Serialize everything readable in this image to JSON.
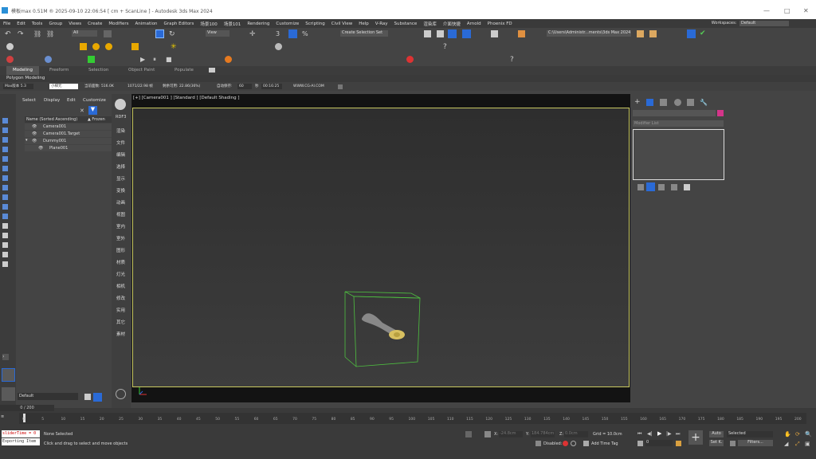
{
  "window": {
    "title": "模板max 0.51M ® 2025-09-10 22:06:54  [ cm + ScanLine ] - Autodesk 3ds Max 2024"
  },
  "menu": [
    "File",
    "Edit",
    "Tools",
    "Group",
    "Views",
    "Create",
    "Modifiers",
    "Animation",
    "Graph Editors",
    "场景100",
    "场景101",
    "Rendering",
    "Customize",
    "Scripting",
    "Civil View",
    "Help",
    "V-Ray",
    "Substance",
    "渲染库",
    "介面快捷",
    "Arnold",
    "Phoenix FD"
  ],
  "workspaces": {
    "label": "Workspaces:",
    "value": "Default"
  },
  "toolbar": {
    "filter": "All",
    "view": "View",
    "selection_set": "Create Selection Set",
    "path": "C:\\Users\\Administr...ments\\3ds Max 2024"
  },
  "ribbon": {
    "tabs": [
      "Modeling",
      "Freeform",
      "Selection",
      "Object Paint",
      "Populate"
    ],
    "active": "Modeling",
    "sub": "Polygon Modeling"
  },
  "infobar": {
    "version": "Max版本 5.3",
    "input": "小梯元",
    "face_count": "当前面数: 516.0K",
    "fps": "1071/22.98 帧",
    "cache": "剩余可用: 22.86(36%)",
    "save_interval": "自动保存:",
    "sec_val": "60",
    "sec_unit": "秒",
    "time": "00:16:25",
    "site": "WWW.CG-AI.COM"
  },
  "scene_explorer": {
    "tabs": [
      "Select",
      "Display",
      "Edit",
      "Customize"
    ],
    "col_name": "Name (Sorted Ascending)",
    "col_frozen": "▲ Frozen",
    "items": [
      "Camera001",
      "Camera001.Target",
      "Dummy001",
      "Plane001"
    ]
  },
  "command_panel": [
    "渲染",
    "文件",
    "编辑",
    "选择",
    "显示",
    "变换",
    "动画",
    "视图",
    "室内",
    "室外",
    "图形",
    "材质",
    "灯光",
    "相机",
    "修改",
    "实用",
    "其它",
    "素材"
  ],
  "cmd_header": "RDF3",
  "viewport": {
    "label": "[+] [Camera001 ] [Standard ] [Default Shading ]"
  },
  "modify": {
    "modifier_list": "Modifier List"
  },
  "layer": {
    "value": "Default"
  },
  "timeline": {
    "frame": "0 / 200",
    "ticks": [
      "0",
      "5",
      "10",
      "15",
      "20",
      "25",
      "30",
      "35",
      "40",
      "45",
      "50",
      "55",
      "60",
      "65",
      "70",
      "75",
      "80",
      "85",
      "90",
      "95",
      "100",
      "105",
      "110",
      "115",
      "120",
      "125",
      "130",
      "135",
      "140",
      "145",
      "150",
      "155",
      "160",
      "165",
      "170",
      "175",
      "180",
      "185",
      "190",
      "195",
      "200"
    ]
  },
  "status": {
    "script1": "sliderTime = 0",
    "script2": "Exporting Item",
    "selection": "None Selected",
    "hint": "Click and drag to select and move objects",
    "x_label": "X:",
    "x_val": "-24.8cm",
    "y_label": "Y:",
    "y_val": "184.784cm",
    "z_label": "Z:",
    "z_val": "0.0cm",
    "grid": "Grid = 10.0cm",
    "disabled": "Disabled:",
    "add_time_tag": "Add Time Tag",
    "auto": "Auto",
    "setk": "Set K.",
    "selected": "Selected",
    "filters": "Filters...",
    "frame": "0"
  }
}
